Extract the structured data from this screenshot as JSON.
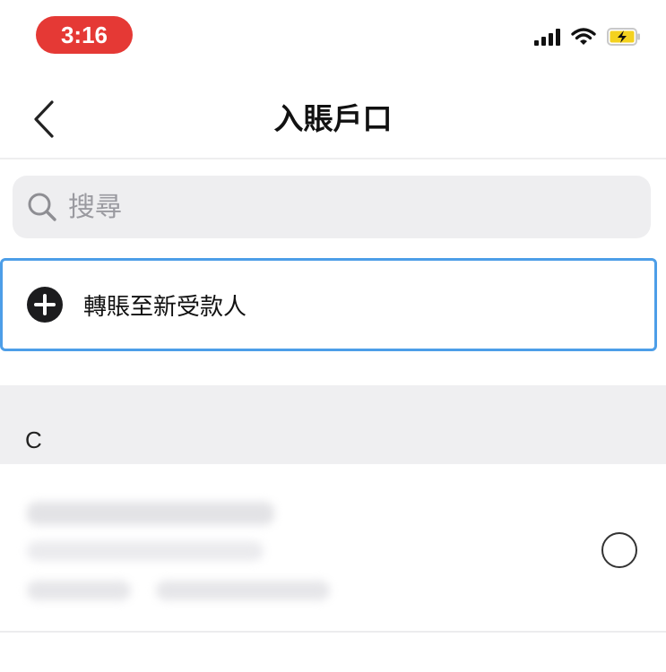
{
  "status_bar": {
    "time": "3:16"
  },
  "header": {
    "title": "入賬戶口",
    "back_icon": "chevron-left-icon"
  },
  "search": {
    "placeholder": "搜尋",
    "value": ""
  },
  "new_payee": {
    "label": "轉賬至新受款人",
    "icon": "plus-circle-icon"
  },
  "sections": [
    {
      "letter": "C"
    }
  ],
  "colors": {
    "time_pill": "#e53935",
    "highlight_border": "#4d9ee8",
    "section_bg": "#efeff1",
    "search_bg": "#eeeef0",
    "battery_fill": "#f4d21f"
  }
}
